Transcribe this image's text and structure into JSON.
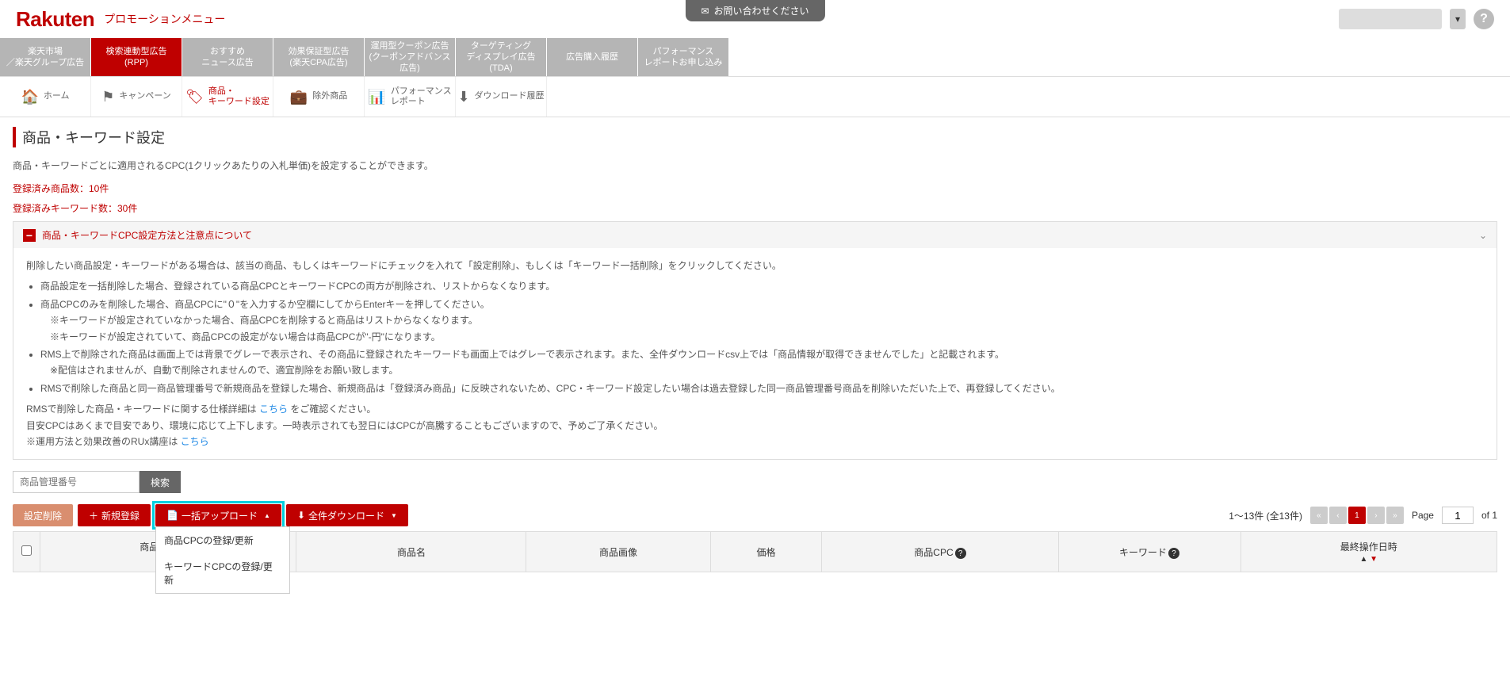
{
  "contact_label": "お問い合わせください",
  "brand": "Rakuten",
  "brand_sub": "プロモーションメニュー",
  "main_nav": [
    {
      "line1": "楽天市場",
      "line2": "／楽天グループ広告"
    },
    {
      "line1": "検索連動型広告",
      "line2": "(RPP)"
    },
    {
      "line1": "おすすめ",
      "line2": "ニュース広告"
    },
    {
      "line1": "効果保証型広告",
      "line2": "(楽天CPA広告)"
    },
    {
      "line1": "運用型クーポン広告",
      "line2": "(クーポンアドバンス",
      "line3": "広告)"
    },
    {
      "line1": "ターゲティング",
      "line2": "ディスプレイ広告",
      "line3": "(TDA)"
    },
    {
      "line1": "広告購入履歴",
      "line2": ""
    },
    {
      "line1": "パフォーマンス",
      "line2": "レポートお申し込み"
    }
  ],
  "sub_nav": [
    {
      "label": "ホーム"
    },
    {
      "label": "キャンペーン"
    },
    {
      "label": "商品・\nキーワード設定"
    },
    {
      "label": "除外商品"
    },
    {
      "label": "パフォーマンス\nレポート"
    },
    {
      "label": "ダウンロード履歴"
    }
  ],
  "page_title": "商品・キーワード設定",
  "page_desc": "商品・キーワードごとに適用されるCPC(1クリックあたりの入札単価)を設定することができます。",
  "stat_products": "登録済み商品数：10件",
  "stat_keywords": "登録済みキーワード数：30件",
  "accordion_title": "商品・キーワードCPC設定方法と注意点について",
  "info": {
    "p1": "削除したい商品設定・キーワードがある場合は、該当の商品、もしくはキーワードにチェックを入れて「設定削除」、もしくは「キーワード一括削除」をクリックしてください。",
    "b1": "商品設定を一括削除した場合、登録されている商品CPCとキーワードCPCの両方が削除され、リストからなくなります。",
    "b2": "商品CPCのみを削除した場合、商品CPCに\"０\"を入力するか空欄にしてからEnterキーを押してください。",
    "b2a": "※キーワードが設定されていなかった場合、商品CPCを削除すると商品はリストからなくなります。",
    "b2b": "※キーワードが設定されていて、商品CPCの設定がない場合は商品CPCが\"-円\"になります。",
    "b3": "RMS上で削除された商品は画面上では背景でグレーで表示され、その商品に登録されたキーワードも画面上ではグレーで表示されます。また、全件ダウンロードcsv上では「商品情報が取得できませんでした」と記載されます。",
    "b3a": "※配信はされませんが、自動で削除されませんので、適宜削除をお願い致します。",
    "b4": "RMSで削除した商品と同一商品管理番号で新規商品を登録した場合、新規商品は「登録済み商品」に反映されないため、CPC・キーワード設定したい場合は過去登録した同一商品管理番号商品を削除いただいた上で、再登録してください。",
    "p2a": "RMSで削除した商品・キーワードに関する仕様詳細は ",
    "p2link": "こちら",
    "p2b": " をご確認ください。",
    "p3": "目安CPCはあくまで目安であり、環境に応じて上下します。一時表示されても翌日にはCPCが高騰することもございますので、予めご了承ください。",
    "p4a": "※運用方法と効果改善のRUx講座は ",
    "p4link": "こちら"
  },
  "search_placeholder": "商品管理番号",
  "search_btn": "検索",
  "btn_delete": "設定削除",
  "btn_new": "新規登録",
  "btn_upload": "一括アップロード",
  "btn_download": "全件ダウンロード",
  "upload_menu": {
    "item1": "商品CPCの登録/更新",
    "item2": "キーワードCPCの登録/更新"
  },
  "pager": {
    "summary": "1～13件 (全13件)",
    "page_label": "Page",
    "current": "1",
    "of_label": "of 1"
  },
  "table_headers": {
    "mgmt_no": "商品管理番号",
    "name": "商品名",
    "image": "商品画像",
    "price": "価格",
    "cpc": "商品CPC",
    "keyword": "キーワード",
    "last_op": "最終操作日時"
  }
}
